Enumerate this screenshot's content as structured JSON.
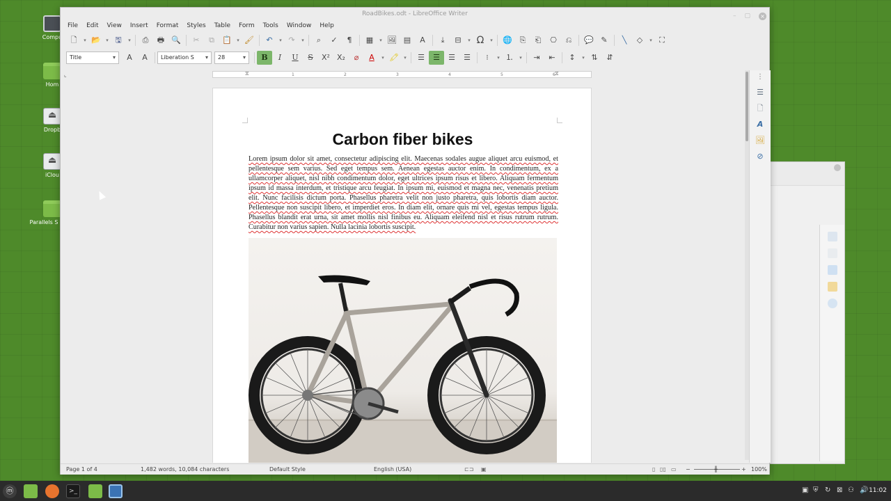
{
  "window": {
    "title": "RoadBikes.odt - LibreOffice Writer",
    "controls": {
      "minimize": "–",
      "maximize": "▢",
      "close": "×"
    }
  },
  "menu": [
    "File",
    "Edit",
    "View",
    "Insert",
    "Format",
    "Styles",
    "Table",
    "Form",
    "Tools",
    "Window",
    "Help"
  ],
  "format_toolbar": {
    "paragraph_style": "Title",
    "font_name": "Liberation S",
    "font_size": "28",
    "bold": "B",
    "italic": "I",
    "underline": "U",
    "strikethrough": "S",
    "superscript": "X²",
    "subscript": "X₂"
  },
  "ruler": {
    "marks": [
      "1",
      "2",
      "3",
      "4",
      "5",
      "6"
    ]
  },
  "document": {
    "title": "Carbon fiber bikes",
    "paragraph": "Lorem ipsum dolor sit amet, consectetur adipiscing elit. Maecenas sodales augue aliquet arcu euismod, et pellentesque sem varius. Sed eget tempus sem. Aenean egestas auctor enim. In condimentum, ex a ullamcorper aliquet, nisl nibh condimentum dolor, eget ultrices ipsum risus et libero. Aliquam fermentum ipsum id massa interdum, et tristique arcu feugiat. In ipsum mi, euismod et magna nec, venenatis pretium elit. Nunc facilisis dictum porta. Phasellus pharetra velit non justo pharetra, quis lobortis diam auctor. Pellentesque non suscipit libero, et imperdiet eros. In diam elit, ornare quis mi vel, egestas tempus ligula. Phasellus blandit erat urna, sit amet mollis nisl finibus eu. Aliquam eleifend nisl et risus rutrum rutrum. Curabitur non varius sapien. Nulla lacinia lobortis suscipit."
  },
  "statusbar": {
    "page": "Page 1 of 4",
    "words": "1,482 words, 10,084 characters",
    "style": "Default Style",
    "language": "English (USA)",
    "zoom": "100%"
  },
  "desktop_icons": [
    "Compu",
    "Hom",
    "Dropb",
    "iClou",
    "Parallels S Folde"
  ],
  "taskbar": {
    "time": "11:02"
  }
}
